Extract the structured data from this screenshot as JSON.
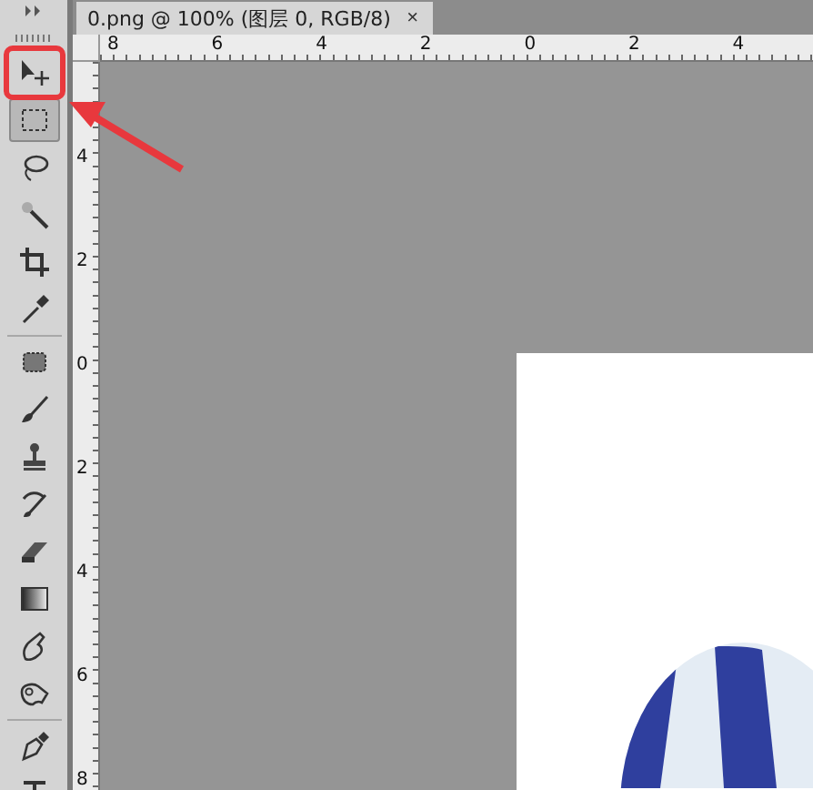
{
  "document_tab": {
    "title": "0.png @ 100% (图层 0, RGB/8)",
    "close": "×"
  },
  "horizontal_ruler": {
    "labels": [
      "8",
      "6",
      "4",
      "2",
      "0",
      "2",
      "4"
    ]
  },
  "vertical_ruler": {
    "labels": [
      "4",
      "2",
      "0",
      "2",
      "4",
      "6",
      "8"
    ]
  },
  "tools": [
    {
      "kind": "move",
      "selected": false,
      "highlighted": true
    },
    {
      "kind": "marquee",
      "selected": true,
      "highlighted": false
    },
    {
      "kind": "lasso",
      "selected": false,
      "highlighted": false
    },
    {
      "kind": "wand",
      "selected": false,
      "highlighted": false
    },
    {
      "kind": "crop",
      "selected": false,
      "highlighted": false
    },
    {
      "kind": "eyedropper",
      "selected": false,
      "highlighted": false
    },
    {
      "kind": "separator"
    },
    {
      "kind": "healing",
      "selected": false,
      "highlighted": false
    },
    {
      "kind": "brush",
      "selected": false,
      "highlighted": false
    },
    {
      "kind": "stamp",
      "selected": false,
      "highlighted": false
    },
    {
      "kind": "history",
      "selected": false,
      "highlighted": false
    },
    {
      "kind": "eraser",
      "selected": false,
      "highlighted": false
    },
    {
      "kind": "gradient",
      "selected": false,
      "highlighted": false
    },
    {
      "kind": "smudge",
      "selected": false,
      "highlighted": false
    },
    {
      "kind": "dodge",
      "selected": false,
      "highlighted": false
    },
    {
      "kind": "separator"
    },
    {
      "kind": "pen",
      "selected": false,
      "highlighted": false
    },
    {
      "kind": "type",
      "selected": false,
      "highlighted": false
    }
  ]
}
